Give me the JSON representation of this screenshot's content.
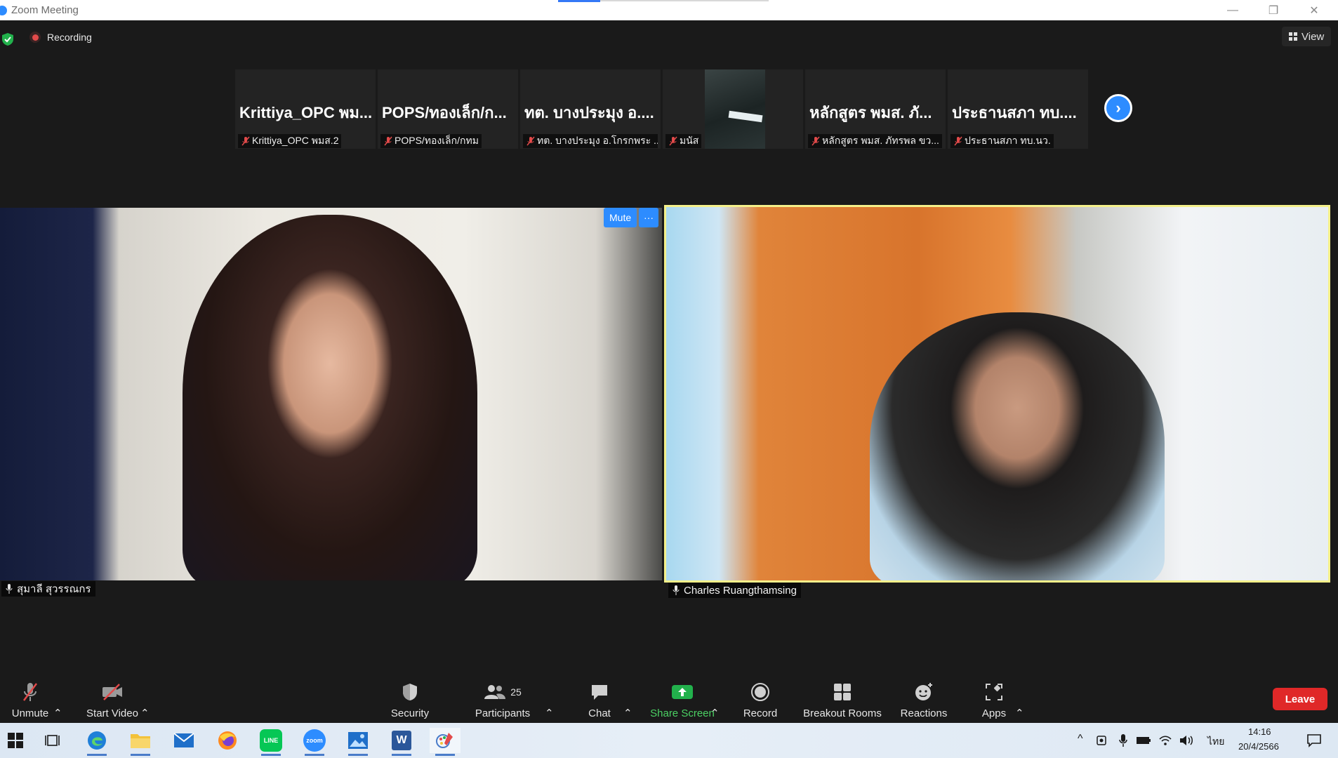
{
  "window": {
    "title": "Zoom Meeting",
    "minimize_icon": "—",
    "maximize_icon": "❐",
    "close_icon": "✕"
  },
  "meeting": {
    "recording_label": "Recording",
    "view_label": "View"
  },
  "thumbnails": [
    {
      "display": "Krittiya_OPC พม...",
      "name": "Krittiya_OPC พมส.2"
    },
    {
      "display": "POPS/ทองเล็ก/ก...",
      "name": "POPS/ทองเล็ก/กทม"
    },
    {
      "display": "ทต. บางประมุง อ....",
      "name": "ทต. บางประมุง อ.โกรกพระ ..."
    },
    {
      "display": "",
      "name": "มนัส"
    },
    {
      "display": "หลักสูตร พมส. ภั...",
      "name": "หลักสูตร พมส. ภัทรพล ขว..."
    },
    {
      "display": "ประธานสภา ทบ....",
      "name": "ประธานสภา ทบ.นว."
    }
  ],
  "next_page_icon": "›",
  "tiles": {
    "left": {
      "name": "สุมาลี สุวรรณกร",
      "mute_label": "Mute",
      "more_label": "···"
    },
    "right": {
      "name": "Charles Ruangthamsing"
    }
  },
  "toolbar": {
    "unmute": "Unmute",
    "start_video": "Start Video",
    "security": "Security",
    "participants": "Participants",
    "participants_count": "25",
    "chat": "Chat",
    "share_screen": "Share Screen",
    "record": "Record",
    "breakout_rooms": "Breakout Rooms",
    "reactions": "Reactions",
    "apps": "Apps",
    "leave": "Leave",
    "caret": "⌃"
  },
  "taskbar": {
    "line_label": "LINE",
    "zoom_label": "zoom",
    "word_label": "W",
    "language": "ไทย",
    "time": "14:16",
    "date": "20/4/2566"
  },
  "colors": {
    "accent": "#2d8cff",
    "active_speaker_border": "#f4f08a",
    "leave": "#e02828",
    "share_green": "#4bd163",
    "mute_red": "#e24a4a"
  }
}
